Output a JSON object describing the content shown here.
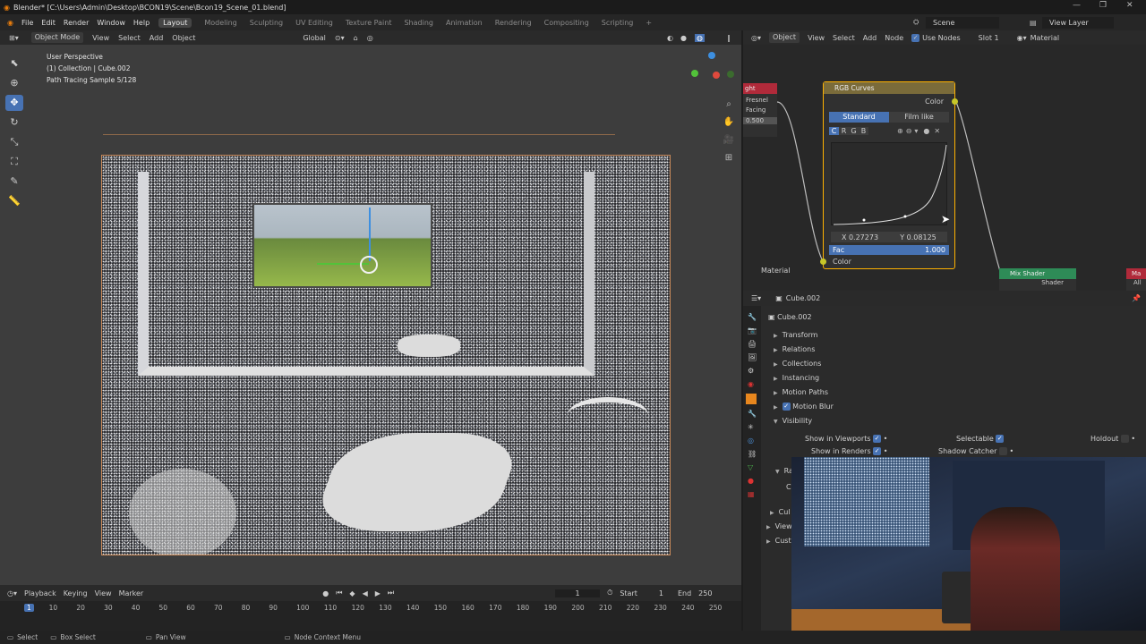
{
  "titlebar": {
    "title": "Blender* [C:\\Users\\Admin\\Desktop\\BCON19\\Scene\\Bcon19_Scene_01.blend]"
  },
  "menus": [
    "File",
    "Edit",
    "Render",
    "Window",
    "Help"
  ],
  "workspaces": [
    "Layout",
    "Modeling",
    "Sculpting",
    "UV Editing",
    "Texture Paint",
    "Shading",
    "Animation",
    "Rendering",
    "Compositing",
    "Scripting"
  ],
  "active_workspace": "Layout",
  "scene": "Scene",
  "view_layer": "View Layer",
  "viewport_header": {
    "mode": "Object Mode",
    "menus": [
      "View",
      "Select",
      "Add",
      "Object"
    ],
    "orientation": "Global"
  },
  "overlay_text": [
    "User Perspective",
    "(1) Collection | Cube.002",
    "Path Tracing Sample 5/128"
  ],
  "node_header": {
    "type": "Object",
    "menus": [
      "View",
      "Select",
      "Add",
      "Node"
    ],
    "use_nodes": "Use Nodes",
    "slot": "Slot 1",
    "material": "Material"
  },
  "rgb_node": {
    "title": "RGB Curves",
    "output": "Color",
    "tabs": [
      "Standard",
      "Film like"
    ],
    "channels": [
      "C",
      "R",
      "G",
      "B"
    ],
    "x": "X 0.27273",
    "y": "Y 0.08125",
    "fac_label": "Fac",
    "fac_value": "1.000",
    "input": "Color"
  },
  "left_node": {
    "title": "ght",
    "fresnel": "Fresnel",
    "facing": "Facing",
    "value": "0.500"
  },
  "node_labels": {
    "material": "Material",
    "mix_shader": "Mix Shader",
    "shader": "Shader",
    "ma": "Ma",
    "all": "All"
  },
  "props": {
    "object": "Cube.002",
    "name": "Cube.002",
    "panels": [
      "Transform",
      "Relations",
      "Collections",
      "Instancing",
      "Motion Paths",
      "Motion Blur",
      "Visibility"
    ],
    "show_viewports": "Show in Viewports",
    "show_renders": "Show in Renders",
    "selectable": "Selectable",
    "shadow_catcher": "Shadow Catcher",
    "holdout": "Holdout",
    "partial": [
      "Ray",
      "C",
      "Cul",
      "View",
      "Custo"
    ]
  },
  "timeline": {
    "menus": [
      "Playback",
      "Keying",
      "View",
      "Marker"
    ],
    "current_frame": "1",
    "start_label": "Start",
    "start": "1",
    "end_label": "End",
    "end": "250",
    "ticks": [
      "1",
      "10",
      "20",
      "30",
      "40",
      "50",
      "60",
      "70",
      "80",
      "90",
      "100",
      "110",
      "120",
      "130",
      "140",
      "150",
      "160",
      "170",
      "180",
      "190",
      "200",
      "210",
      "220",
      "230",
      "240",
      "250"
    ]
  },
  "status": {
    "select": "Select",
    "box_select": "Box Select",
    "pan_view": "Pan View",
    "node_ctx": "Node Context Menu"
  },
  "colors": {
    "accent": "#4772b3",
    "node_border": "#ffb200",
    "mix_shader": "#2e8b57"
  }
}
